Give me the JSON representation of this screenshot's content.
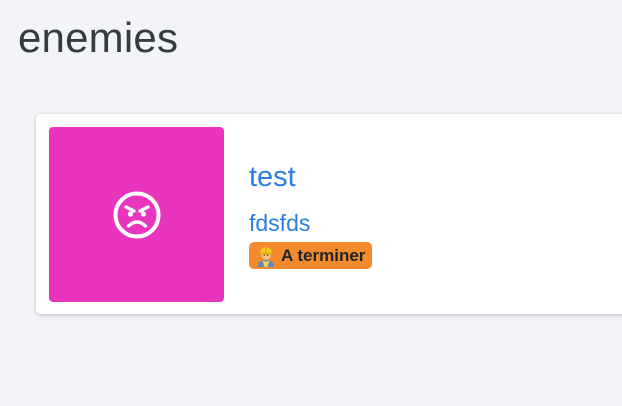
{
  "page": {
    "title": "enemies"
  },
  "card": {
    "title": "test",
    "subtitle": "fdsfds",
    "thumbnail_color": "#e935bd",
    "thumbnail_icon": "angry-face-icon",
    "badge": {
      "label": "A terminer",
      "icon": "construction-worker-icon",
      "color": "#f28a2e"
    }
  },
  "colors": {
    "link": "#2b7de0",
    "background": "#f3f4f8",
    "heading": "#363b41"
  }
}
